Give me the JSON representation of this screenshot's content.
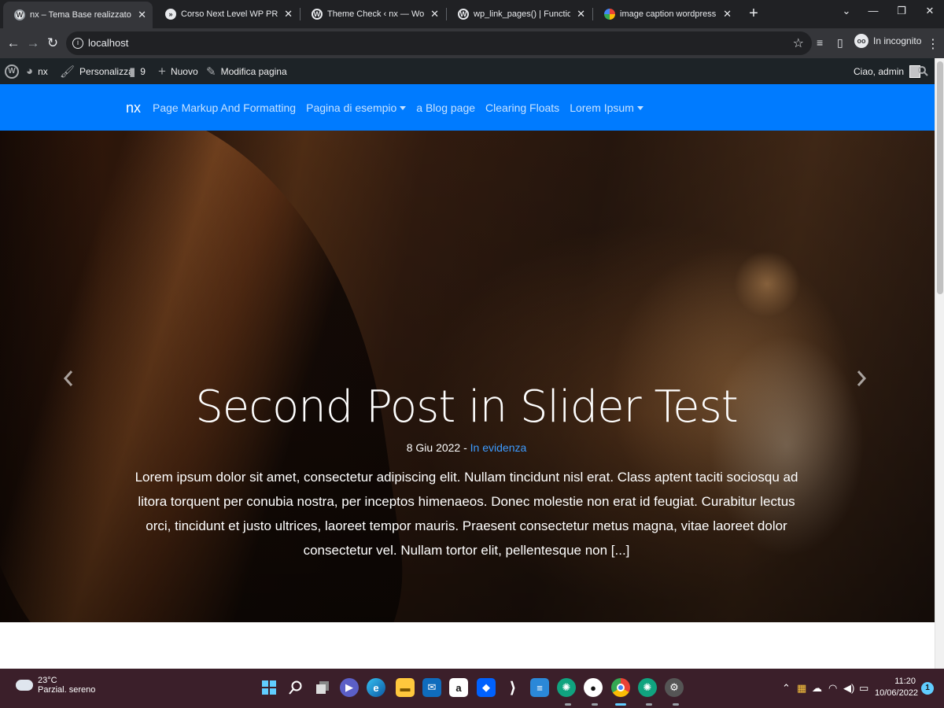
{
  "browser": {
    "tabs": [
      {
        "title": "nx – Tema Base realizzato con Bo",
        "icon": "wordpress-icon"
      },
      {
        "title": "Corso Next Level WP PRO – Marc",
        "icon": "course-icon"
      },
      {
        "title": "Theme Check ‹ nx — WordPress",
        "icon": "wordpress-icon"
      },
      {
        "title": "wp_link_pages() | Function | Word",
        "icon": "wordpress-icon"
      },
      {
        "title": "image caption wordpress - Cerca",
        "icon": "google-icon"
      }
    ],
    "url": "localhost",
    "incognito_label": "In incognito"
  },
  "adminbar": {
    "site_name": "nx",
    "customize": "Personalizza",
    "comments_count": "9",
    "new": "Nuovo",
    "edit_page": "Modifica pagina",
    "greeting": "Ciao, admin"
  },
  "navbar": {
    "brand": "nx",
    "links": [
      {
        "label": "Page Markup And Formatting",
        "dropdown": false
      },
      {
        "label": "Pagina di esempio",
        "dropdown": true
      },
      {
        "label": "a Blog page",
        "dropdown": false
      },
      {
        "label": "Clearing Floats",
        "dropdown": false
      },
      {
        "label": "Lorem Ipsum",
        "dropdown": true
      }
    ],
    "color": "#007bff"
  },
  "slider": {
    "title": "Second Post in Slider Test",
    "date": "8 Giu 2022",
    "separator": "-",
    "category": "In evidenza",
    "excerpt": "Lorem ipsum dolor sit amet, consectetur adipiscing elit. Nullam tincidunt nisl erat. Class aptent taciti sociosqu ad litora torquent per conubia nostra, per inceptos himenaeos. Donec molestie non erat id feugiat. Curabitur lectus orci, tincidunt et justo ultrices, laoreet tempor mauris. Praesent consectetur metus magna, vitae laoreet dolor consectetur vel. Nullam tortor elit, pellentesque non [...]",
    "link_color": "#3d9bff"
  },
  "taskbar": {
    "temperature": "23°C",
    "weather": "Parzial. sereno",
    "time": "11:20",
    "date": "10/06/2022",
    "notifications": "1",
    "apps": [
      "start-icon",
      "search-icon",
      "task-view-icon",
      "teams-icon",
      "edge-icon",
      "file-explorer-icon",
      "mail-icon",
      "amazon-icon",
      "dropbox-icon",
      "terminal-icon",
      "notepad-icon",
      "chatgpt-icon",
      "github-icon",
      "chrome-icon",
      "chatgpt-icon",
      "settings-icon"
    ]
  }
}
